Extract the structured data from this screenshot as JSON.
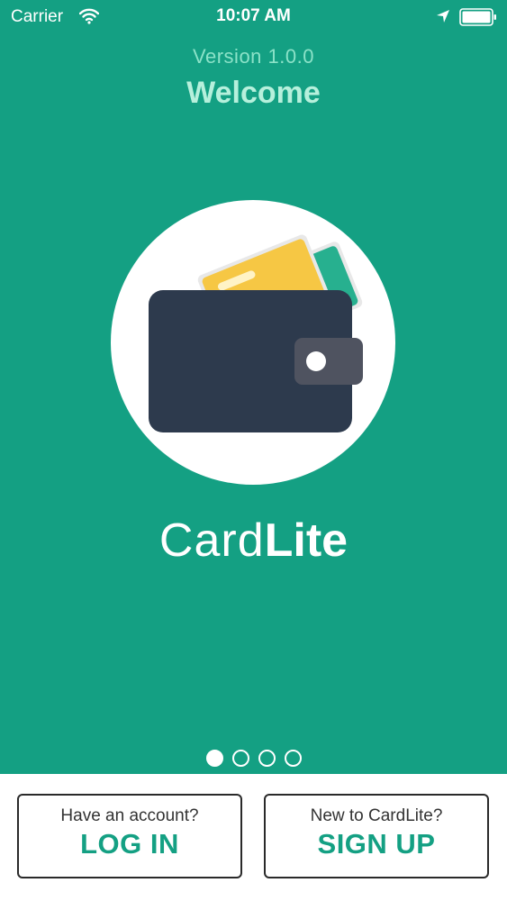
{
  "status_bar": {
    "carrier": "Carrier",
    "time": "10:07 AM",
    "icons": [
      "wifi-icon",
      "location-icon",
      "battery-icon"
    ]
  },
  "header": {
    "version": "Version 1.0.0",
    "title": "Welcome"
  },
  "logo": {
    "icon": "wallet-icon",
    "brand_light": "Card",
    "brand_bold": "Lite"
  },
  "pager": {
    "page_count": 4,
    "current_page": 1
  },
  "actions": {
    "login": {
      "caption": "Have an account?",
      "label": "LOG IN"
    },
    "signup": {
      "caption": "New to CardLite?",
      "label": "SIGN UP"
    }
  },
  "colors": {
    "background": "#14a083",
    "accent": "#14a083",
    "wallet": "#2d3a4d",
    "card_yellow": "#f6c744",
    "card_green": "#27b08f"
  }
}
